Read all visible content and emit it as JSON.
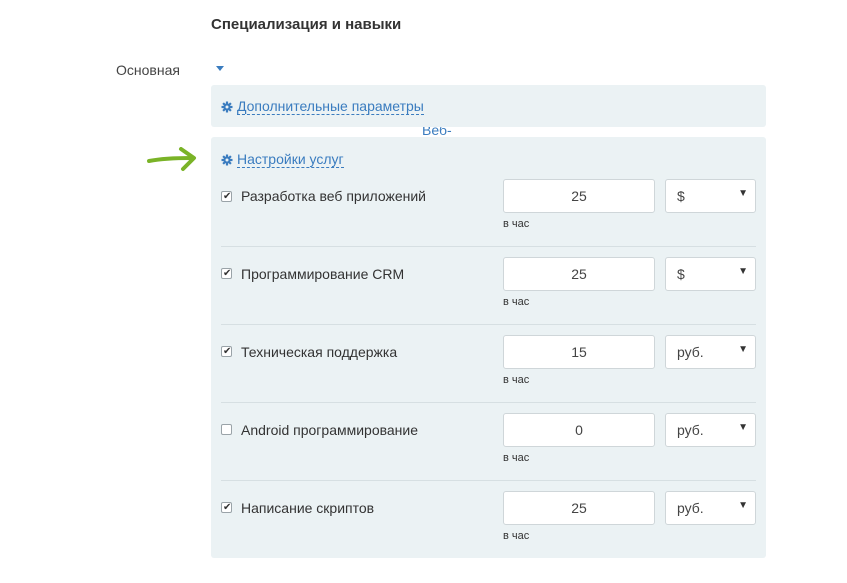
{
  "section": {
    "title": "Специализация и навыки"
  },
  "main": {
    "label": "Основная",
    "specialization": "Веб-программирование"
  },
  "extra_params": {
    "label": "Дополнительные параметры",
    "icon": "gear-icon"
  },
  "services": {
    "title": "Настройки услуг",
    "icon": "gear-icon",
    "per_hour_label": "в час",
    "items": [
      {
        "name": "Разработка веб приложений",
        "checked": true,
        "price": "25",
        "currency": "$"
      },
      {
        "name": "Программирование CRM",
        "checked": true,
        "price": "25",
        "currency": "$"
      },
      {
        "name": "Техническая поддержка",
        "checked": true,
        "price": "15",
        "currency": "руб."
      },
      {
        "name": "Android программирование",
        "checked": false,
        "price": "0",
        "currency": "руб."
      },
      {
        "name": "Написание скриптов",
        "checked": true,
        "price": "25",
        "currency": "руб."
      }
    ]
  },
  "colors": {
    "link": "#3a7cbf",
    "panel_bg": "#ebf2f4",
    "arrow": "#7ab327"
  }
}
